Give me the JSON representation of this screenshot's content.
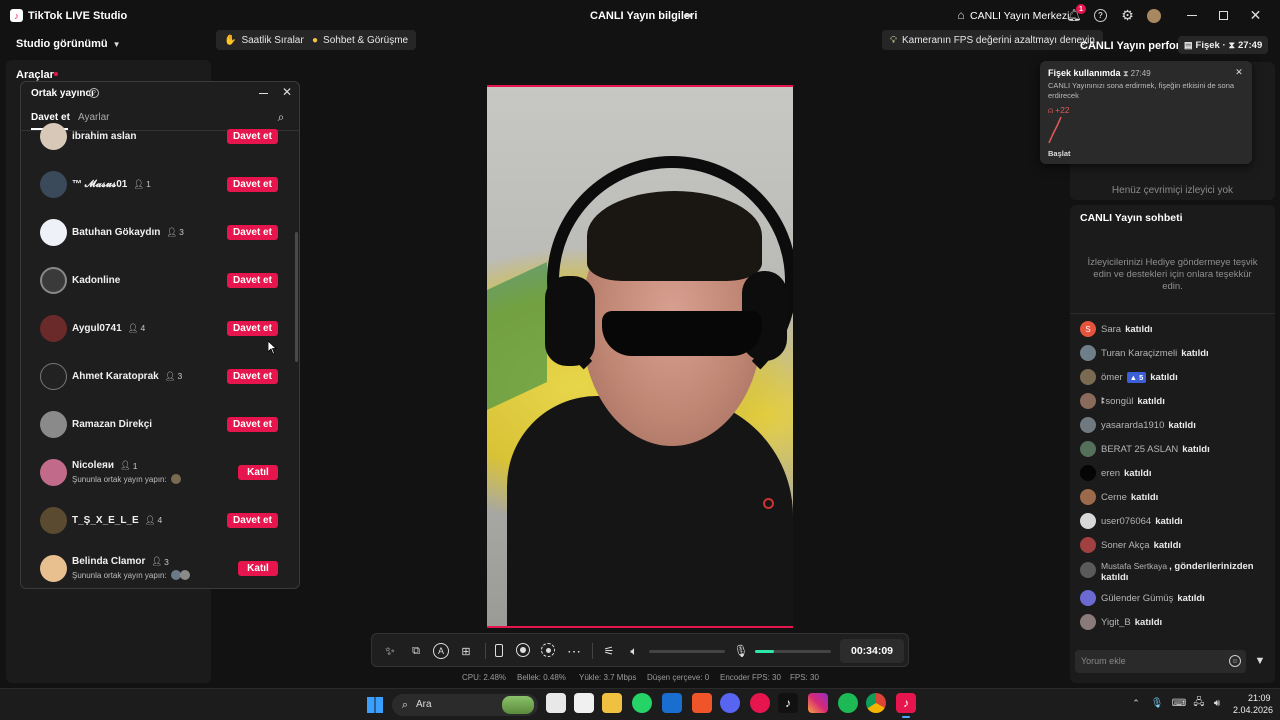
{
  "titlebar": {
    "app_title": "TikTok LIVE Studio",
    "center_title": "CANLI Yayın bilgileri",
    "live_center": "CANLI Yayın Merkezi",
    "notif_count": "1"
  },
  "left": {
    "studio_view": "Studio görünümü",
    "tools": "Araçlar"
  },
  "top_pills": {
    "hourly_rank": "Saatlik Sıralama",
    "chat_meet": "Sohbet & Görüşme",
    "fps_tip": "Kameranın FPS değerini azaltmayı deneyin"
  },
  "cohost": {
    "title": "Ortak yayıncı",
    "tabs": [
      "Davet et",
      "Ayarlar"
    ],
    "users": [
      {
        "name": "ibrahim aslan",
        "count": "",
        "action": "Davet et",
        "sub": ""
      },
      {
        "name": "™ 𝓜𝓪𝓼𝓾𝓼01",
        "count": "1",
        "action": "Davet et",
        "sub": ""
      },
      {
        "name": "Batuhan Gökaydın",
        "count": "3",
        "action": "Davet et",
        "sub": ""
      },
      {
        "name": "Kadonline",
        "count": "",
        "action": "Davet et",
        "sub": ""
      },
      {
        "name": "Aygul0741",
        "count": "4",
        "action": "Davet et",
        "sub": ""
      },
      {
        "name": "Ahmet Karatoprak",
        "count": "3",
        "action": "Davet et",
        "sub": ""
      },
      {
        "name": "Ramazan Direkçi",
        "count": "",
        "action": "Davet et",
        "sub": ""
      },
      {
        "name": "Nicoleяи",
        "count": "1",
        "action": "Katıl",
        "sub": "Şununla ortak yayın yapın:"
      },
      {
        "name": "T_Ş_X_E_L_E",
        "count": "4",
        "action": "Davet et",
        "sub": ""
      },
      {
        "name": "Belinda Clamor",
        "count": "3",
        "action": "Katıl",
        "sub": "Şununla ortak yayın yapın:"
      }
    ]
  },
  "performance": {
    "title": "CANLI Yayın perfor...",
    "badge": "Fişek · ",
    "badge_time": "27:49"
  },
  "firework_popup": {
    "title": "Fişek kullanımda",
    "time": "27:49",
    "desc": "CANLI Yayınınızı sona erdirmek, fişeğin etkisini de sona erdirecek",
    "viewers_delta": "+22",
    "start_label": "Başlat"
  },
  "viewers_empty": "Henüz çevrimiçi izleyici yok",
  "chat": {
    "title": "CANLI Yayın sohbeti",
    "hint": "İzleyicilerinizi Hediye göndermeye teşvik edin ve destekleri için onlara teşekkür edin.",
    "messages": [
      {
        "user": "Sara",
        "action": "katıldı",
        "color": "#e5533d"
      },
      {
        "user": "Turan Karaçizmeli",
        "action": "katıldı",
        "color": "#6f7f8a"
      },
      {
        "user": "ömer",
        "action": "katıldı",
        "color": "#7a6a52",
        "level": "5"
      },
      {
        "user": "ꔪsongül",
        "action": "katıldı",
        "color": "#8a6a5a"
      },
      {
        "user": "yasararda1910",
        "action": "katıldı",
        "color": "#707880"
      },
      {
        "user": "BERAT 25 ASLAN",
        "action": "katıldı",
        "color": "#55705a"
      },
      {
        "user": "eren",
        "action": "katıldı",
        "color": "#050505"
      },
      {
        "user": "Cerne",
        "action": "katıldı",
        "color": "#9a6a4a"
      },
      {
        "user": "user076064",
        "action": "katıldı",
        "color": "#d8d8d8"
      },
      {
        "user": "Soner Akça",
        "action": "katıldı",
        "color": "#a04040"
      },
      {
        "user": "Mustafa Sertkaya",
        "action": ", gönderilerinizden katıldı",
        "color": "#5a5a5a"
      },
      {
        "user": "Gülender Gümüş",
        "action": "katıldı",
        "color": "#6a6ad0"
      },
      {
        "user": "Yigit_B",
        "action": "katıldı",
        "color": "#8a7a7a"
      }
    ],
    "placeholder": "Yorum ekle"
  },
  "controls": {
    "timer": "00:34:09"
  },
  "stats": {
    "cpu": "CPU:  2.48%",
    "memory": "Bellek:  0.48%",
    "upload": "Yükle:  3.7 Mbps",
    "dropped": "Düşen çerçeve:  0",
    "encoder": "Encoder FPS:  30",
    "fps": "FPS:  30"
  },
  "taskbar": {
    "search": "Ara",
    "time": "21:09",
    "date": "2.04.2026"
  },
  "colors": {
    "accent": "#e6154e",
    "level_bar": "#2ee6a8"
  }
}
